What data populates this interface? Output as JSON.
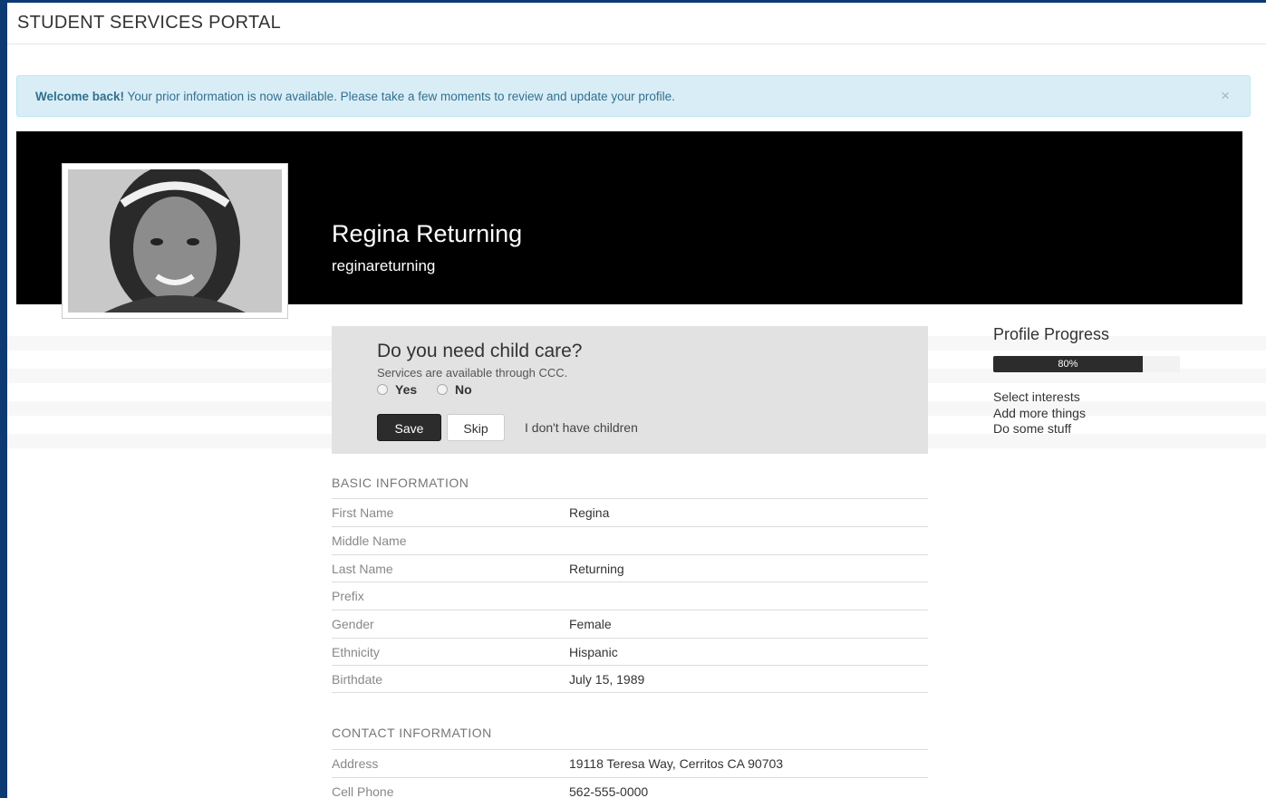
{
  "header": {
    "brand": "STUDENT SERVICES PORTAL"
  },
  "alert": {
    "strong": "Welcome back!",
    "message": " Your prior information is now available. Please take a few moments to review and update your profile.",
    "close_symbol": "×"
  },
  "profile": {
    "full_name": "Regina Returning",
    "username": "reginareturning"
  },
  "childcare_card": {
    "question": "Do you need child care?",
    "subtext": "Services are available through CCC.",
    "options": [
      "Yes",
      "No"
    ],
    "save_label": "Save",
    "skip_label": "Skip",
    "no_children_label": "I don't have children"
  },
  "sidebar": {
    "title": "Profile Progress",
    "progress_label": "80%",
    "progress_value": 0.8,
    "links": [
      "Select interests",
      "Add more things",
      "Do some stuff"
    ]
  },
  "basic_info": {
    "heading": "BASIC INFORMATION",
    "rows": [
      {
        "label": "First Name",
        "value": "Regina"
      },
      {
        "label": "Middle Name",
        "value": ""
      },
      {
        "label": "Last Name",
        "value": "Returning"
      },
      {
        "label": "Prefix",
        "value": ""
      },
      {
        "label": "Gender",
        "value": "Female"
      },
      {
        "label": "Ethnicity",
        "value": "Hispanic"
      },
      {
        "label": "Birthdate",
        "value": "July 15, 1989"
      }
    ]
  },
  "contact_info": {
    "heading": "CONTACT INFORMATION",
    "rows": [
      {
        "label": "Address",
        "value": "19118 Teresa Way, Cerritos CA 90703"
      },
      {
        "label": "Cell Phone",
        "value": "562-555-0000"
      }
    ]
  }
}
